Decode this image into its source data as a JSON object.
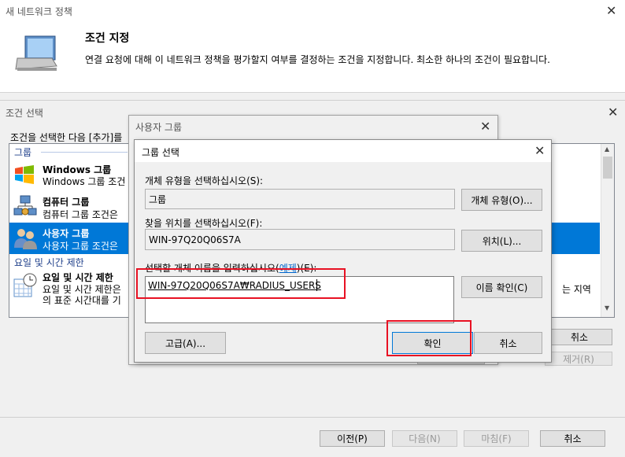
{
  "wizard": {
    "title": "새 네트워크 정책",
    "heading": "조건 지정",
    "description": "연결 요청에 대해 이 네트워크 정책을 평가할지 여부를 결정하는 조건을 지정합니다. 최소한 하나의 조건이 필요합니다.",
    "buttons": {
      "prev": "이전(P)",
      "next": "다음(N)",
      "finish": "마침(F)",
      "cancel": "취소"
    }
  },
  "condition_dialog": {
    "title": "조건 선택",
    "instruction": "조건을 선택한 다음 [추가]를",
    "groups": [
      {
        "header": "그룹",
        "items": [
          {
            "title": "Windows 그룹",
            "desc": "Windows 그룹 조건",
            "selected": false
          },
          {
            "title": "컴퓨터 그룹",
            "desc": "컴퓨터 그룹 조건은",
            "selected": false
          },
          {
            "title": "사용자 그룹",
            "desc": "사용자 그룹 조건은",
            "selected": true
          }
        ]
      },
      {
        "header": "요일 및 시간 제한",
        "items": [
          {
            "title": "요일 및 시간 제한",
            "desc": "요일 및 시간 제한은",
            "desc2": "의 표준 시간대를 기",
            "right_text": "는 지역",
            "selected": false
          }
        ]
      }
    ],
    "cancel_button": "취소",
    "remove_button": "제거(R)"
  },
  "user_group_dialog": {
    "title": "사용자 그룹"
  },
  "select_group": {
    "title": "그룹 선택",
    "object_type_label": "개체 유형을 선택하십시오(S):",
    "object_type_value": "그룹",
    "object_type_button": "개체 유형(O)...",
    "location_label": "찾을 위치를 선택하십시오(F):",
    "location_value": "WIN-97Q20Q06S7A",
    "location_button": "위치(L)...",
    "name_label": "선택할 개체 이름을 입력하십시오(",
    "name_label_link": "예제",
    "name_label_end": ")(E):",
    "name_value": "WIN-97Q20Q06S7A₩RADIUS_USERS",
    "check_names_button": "이름 확인(C)",
    "advanced_button": "고급(A)...",
    "ok_button": "확인",
    "cancel_button": "취소"
  },
  "colors": {
    "selection": "#0078d7",
    "highlight_box": "#e81123",
    "header_text": "#1e3f8a"
  }
}
